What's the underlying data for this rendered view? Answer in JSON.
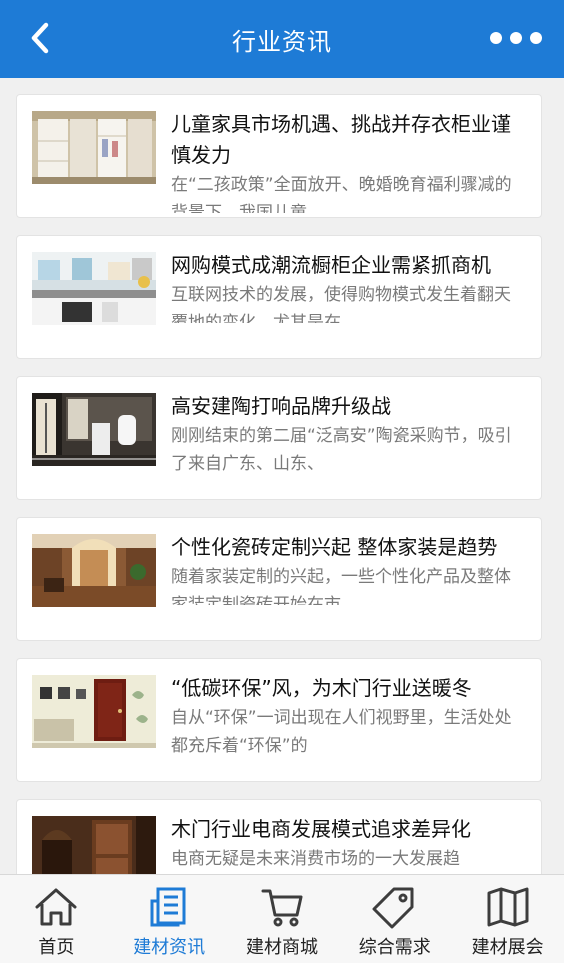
{
  "header": {
    "title": "行业资讯",
    "back_icon": "chevron-left-icon",
    "more_icon": "more-dots-icon"
  },
  "colors": {
    "header_bg": "#1e7bd6",
    "active_nav": "#1e7bd6"
  },
  "articles": [
    {
      "title": "儿童家具市场机遇、挑战并存衣柜业谨慎发力",
      "desc": "在“二孩政策”全面放开、晚婚晚育福利骤减的背景下，我国儿童"
    },
    {
      "title": "网购模式成潮流橱柜企业需紧抓商机",
      "desc": "互联网技术的发展，使得购物模式发生着翻天覆地的变化，尤其是在"
    },
    {
      "title": "高安建陶打响品牌升级战",
      "desc": "刚刚结束的第二届“泛高安”陶瓷采购节，吸引了来自广东、山东、"
    },
    {
      "title": "个性化瓷砖定制兴起 整体家装是趋势",
      "desc": "随着家装定制的兴起，一些个性化产品及整体家装定制瓷砖开始在市"
    },
    {
      "title": "“低碳环保”风，为木门行业送暖冬",
      "desc": "自从“环保”一词出现在人们视野里，生活处处都充斥着“环保”的"
    },
    {
      "title": "木门行业电商发展模式追求差异化",
      "desc": "电商无疑是未来消费市场的一大发展趋"
    }
  ],
  "nav": [
    {
      "label": "首页",
      "icon": "home-icon"
    },
    {
      "label": "建材资讯",
      "icon": "news-icon"
    },
    {
      "label": "建材商城",
      "icon": "cart-icon"
    },
    {
      "label": "综合需求",
      "icon": "tag-icon"
    },
    {
      "label": "建材展会",
      "icon": "map-icon"
    }
  ]
}
